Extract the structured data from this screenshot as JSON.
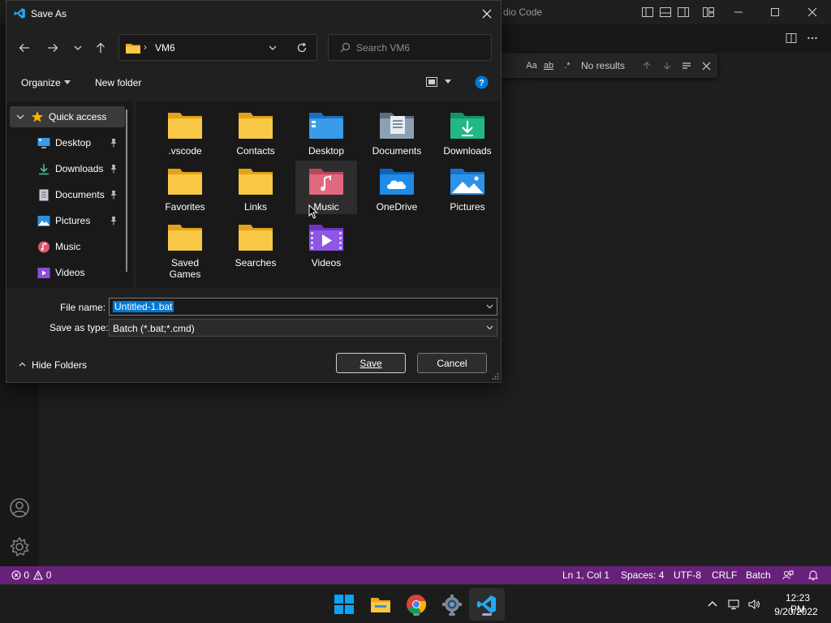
{
  "vscode": {
    "window_title": "dio Code",
    "status": {
      "errors": "0",
      "warnings": "0",
      "position": "Ln 1, Col 1",
      "spaces": "Spaces: 4",
      "encoding": "UTF-8",
      "eol": "CRLF",
      "language": "Batch"
    },
    "find": {
      "match_case": "Aa",
      "match_word": "ab",
      "results": "No results"
    }
  },
  "dialog": {
    "title": "Save As",
    "address": {
      "current": "VM6"
    },
    "search": {
      "placeholder": "Search VM6"
    },
    "toolbar": {
      "organize": "Organize",
      "new_folder": "New folder"
    },
    "nav": {
      "quick_access": "Quick access",
      "items": [
        {
          "label": "Desktop",
          "icon": "desktop-icon",
          "pinned": true
        },
        {
          "label": "Downloads",
          "icon": "downloads-icon",
          "pinned": true
        },
        {
          "label": "Documents",
          "icon": "documents-icon",
          "pinned": true
        },
        {
          "label": "Pictures",
          "icon": "pictures-icon",
          "pinned": true
        },
        {
          "label": "Music",
          "icon": "music-icon",
          "pinned": false
        },
        {
          "label": "Videos",
          "icon": "videos-icon",
          "pinned": false
        }
      ]
    },
    "files": [
      {
        "label": ".vscode",
        "icon": "folder-icon"
      },
      {
        "label": "Contacts",
        "icon": "folder-icon"
      },
      {
        "label": "Desktop",
        "icon": "desktop-folder-icon"
      },
      {
        "label": "Documents",
        "icon": "documents-folder-icon"
      },
      {
        "label": "Downloads",
        "icon": "downloads-folder-icon"
      },
      {
        "label": "Favorites",
        "icon": "folder-icon"
      },
      {
        "label": "Links",
        "icon": "folder-icon"
      },
      {
        "label": "Music",
        "icon": "music-folder-icon"
      },
      {
        "label": "OneDrive",
        "icon": "onedrive-folder-icon"
      },
      {
        "label": "Pictures",
        "icon": "pictures-folder-icon"
      },
      {
        "label": "Saved Games",
        "icon": "folder-icon"
      },
      {
        "label": "Searches",
        "icon": "folder-icon"
      },
      {
        "label": "Videos",
        "icon": "videos-folder-icon"
      }
    ],
    "filename": {
      "label": "File name:",
      "value": "Untitled-1.bat"
    },
    "filetype": {
      "label": "Save as type:",
      "value": "Batch (*.bat;*.cmd)"
    },
    "hide_folders": "Hide Folders",
    "save": "Save",
    "cancel": "Cancel"
  },
  "taskbar": {
    "time": "12:23 PM",
    "date": "9/20/2022"
  },
  "colors": {
    "statusbar": "#68217a",
    "accent": "#0078d4",
    "folder": "#f8c846"
  }
}
